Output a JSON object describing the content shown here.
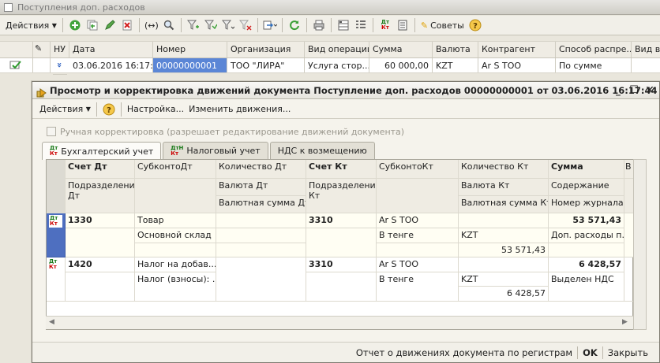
{
  "outer": {
    "title": "Поступления доп. расходов",
    "toolbar": {
      "actions_label": "Действия",
      "tips_label": "Советы"
    },
    "columns": [
      "НУ",
      "Дата",
      "Номер",
      "Организация",
      "Вид операции",
      "Сумма",
      "Валюта",
      "Контрагент",
      "Способ распре...",
      "Вид в"
    ],
    "row": {
      "nu": "»",
      "date": "03.06.2016 16:17:...",
      "number": "00000000001",
      "organization": "ТОО \"ЛИРА\"",
      "operation": "Услуга стор...",
      "amount": "60 000,00",
      "currency": "KZT",
      "contractor": "Ar S TOO",
      "method": "По сумме"
    }
  },
  "dialog": {
    "title": "Просмотр и корректировка движений документа Поступление доп. расходов 00000000001 от 03.06.2016 16:17:44",
    "toolbar": {
      "actions_label": "Действия",
      "settings_label": "Настройка...",
      "change_label": "Изменить движения..."
    },
    "manual_checkbox_label": "Ручная корректировка (разрешает редактирование движений документа)",
    "tabs": [
      "Бухгалтерский учет",
      "Налоговый учет",
      "НДС к возмещению"
    ],
    "grid": {
      "headers": {
        "r1": [
          "Счет Дт",
          "СубконтоДт",
          "Количество Дт",
          "Счет Кт",
          "СубконтоКт",
          "Количество Кт",
          "Сумма",
          "В"
        ],
        "r2": [
          "Подразделение Дт",
          "",
          "Валюта Дт",
          "Подразделение Кт",
          "",
          "Валюта Кт",
          "Содержание"
        ],
        "r3": [
          "",
          "",
          "Валютная сумма Дт",
          "",
          "",
          "Валютная сумма Кт",
          "Номер журнала"
        ]
      },
      "rows": [
        {
          "icon_top": "Дт",
          "icon_bottom": "Кт",
          "acc_dt": "1330",
          "sub_dt_1": "Товар",
          "sub_dt_2": "Основной склад",
          "acc_kt": "3310",
          "sub_kt_1": "Ar S TOO",
          "sub_kt_2": "В тенге",
          "cur_kt": "KZT",
          "val_sum_kt": "53 571,43",
          "sum": "53 571,43",
          "content": "Доп. расходы п..."
        },
        {
          "icon_top": "Дт",
          "icon_bottom": "Кт",
          "acc_dt": "1420",
          "sub_dt_1": "Налог на добав...",
          "sub_dt_2": "Налог (взносы): ...",
          "acc_kt": "3310",
          "sub_kt_1": "Ar S TOO",
          "sub_kt_2": "В тенге",
          "cur_kt": "KZT",
          "val_sum_kt": "6 428,57",
          "sum": "6 428,57",
          "content": "Выделен НДС"
        }
      ]
    },
    "bottom": {
      "report_label": "Отчет о движениях документа по регистрам",
      "ok_label": "OK",
      "close_label": "Закрыть"
    }
  }
}
